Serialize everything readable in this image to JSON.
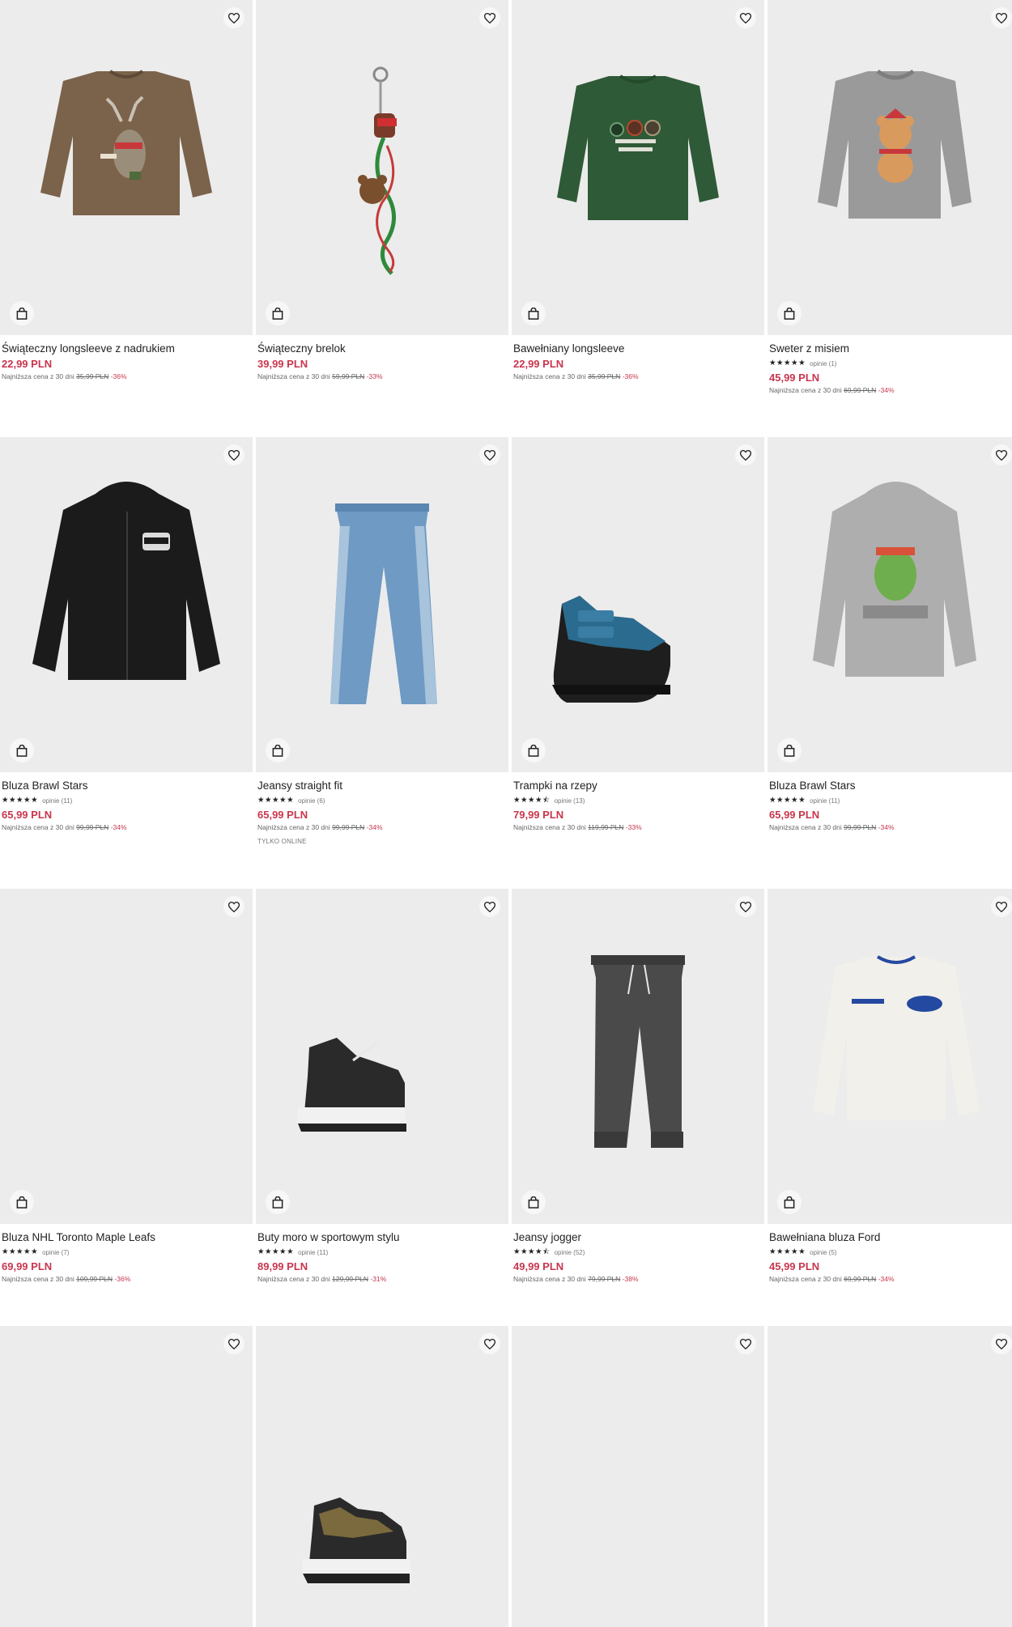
{
  "labels": {
    "lowest_prefix": "Najniższa cena z 30 dni"
  },
  "products": [
    {
      "name": "Świąteczny longsleeve z nadrukiem",
      "price": "22,99 PLN",
      "old_price": "35,99 PLN",
      "discount": "-36%"
    },
    {
      "name": "Świąteczny brelok",
      "price": "39,99 PLN",
      "old_price": "59,99 PLN",
      "discount": "-33%"
    },
    {
      "name": "Bawełniany longsleeve",
      "price": "22,99 PLN",
      "old_price": "35,99 PLN",
      "discount": "-36%"
    },
    {
      "name": "Sweter z misiem",
      "stars": "★★★★★",
      "reviews": "opinie (1)",
      "price": "45,99 PLN",
      "old_price": "69,99 PLN",
      "discount": "-34%"
    },
    {
      "name": "Bluza Brawl Stars",
      "stars": "★★★★★",
      "reviews": "opinie (11)",
      "price": "65,99 PLN",
      "old_price": "99,99 PLN",
      "discount": "-34%"
    },
    {
      "name": "Jeansy straight fit",
      "stars": "★★★★★",
      "reviews": "opinie (6)",
      "price": "65,99 PLN",
      "old_price": "99,99 PLN",
      "discount": "-34%",
      "badge": "TYLKO ONLINE"
    },
    {
      "name": "Trampki na rzepy",
      "stars": "★★★★⯪",
      "reviews": "opinie (13)",
      "price": "79,99 PLN",
      "old_price": "119,99 PLN",
      "discount": "-33%"
    },
    {
      "name": "Bluza Brawl Stars",
      "stars": "★★★★★",
      "reviews": "opinie (11)",
      "price": "65,99 PLN",
      "old_price": "99,99 PLN",
      "discount": "-34%"
    },
    {
      "name": "Bluza NHL Toronto Maple Leafs",
      "stars": "★★★★★",
      "reviews": "opinie (7)",
      "price": "69,99 PLN",
      "old_price": "109,99 PLN",
      "discount": "-36%"
    },
    {
      "name": "Buty moro w sportowym stylu",
      "stars": "★★★★★",
      "reviews": "opinie (11)",
      "price": "89,99 PLN",
      "old_price": "129,99 PLN",
      "discount": "-31%"
    },
    {
      "name": "Jeansy jogger",
      "stars": "★★★★⯪",
      "reviews": "opinie (52)",
      "price": "49,99 PLN",
      "old_price": "79,99 PLN",
      "discount": "-38%"
    },
    {
      "name": "Bawełniana bluza Ford",
      "stars": "★★★★★",
      "reviews": "opinie (5)",
      "price": "45,99 PLN",
      "old_price": "69,99 PLN",
      "discount": "-34%"
    },
    {},
    {},
    {},
    {}
  ]
}
